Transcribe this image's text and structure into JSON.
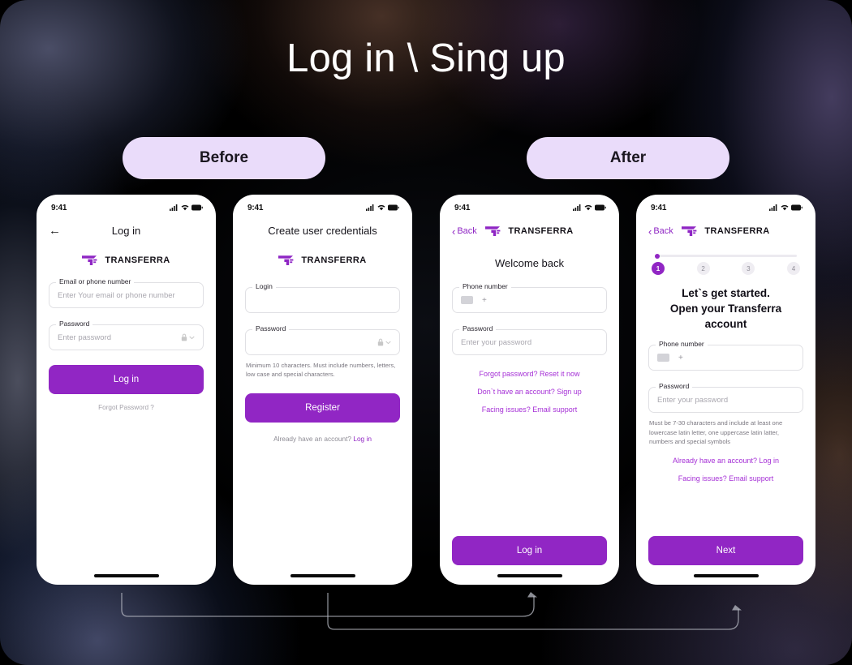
{
  "page": {
    "title": "Log in \\ Sing up",
    "accent": "#9126c4",
    "pill_bg": "#eadcfa"
  },
  "labels": {
    "before": "Before",
    "after": "After"
  },
  "status_bar": {
    "time": "9:41",
    "icons": [
      "signal-icon",
      "wifi-icon",
      "battery-icon"
    ]
  },
  "brand": {
    "name": "TRANSFERRA"
  },
  "screens": [
    {
      "id": "login-before",
      "nav_title": "Log in",
      "back_arrow": "←",
      "fields": [
        {
          "label": "Email or phone number",
          "placeholder": "Enter Your email or phone number"
        },
        {
          "label": "Password",
          "placeholder": "Enter password"
        }
      ],
      "primary_button": "Log in",
      "footer_link": "Forgot Password ?"
    },
    {
      "id": "register-before",
      "heading": "Create user credentials",
      "fields": [
        {
          "label": "Login",
          "placeholder": ""
        },
        {
          "label": "Password",
          "placeholder": ""
        }
      ],
      "helper_text": "Minimum 10 characters. Must include numbers, letters, low case and special characters.",
      "primary_button": "Register",
      "footer_note": "Already have an account?",
      "footer_link": "Log in"
    },
    {
      "id": "login-after",
      "back_label": "Back",
      "heading": "Welcome back",
      "fields": [
        {
          "label": "Phone number",
          "placeholder": "",
          "prefix": "+"
        },
        {
          "label": "Password",
          "placeholder": "Enter your password"
        }
      ],
      "links": [
        "Forgot password? Reset it now",
        "Don`t have an account? Sign up",
        "Facing issues? Email support"
      ],
      "primary_button": "Log in"
    },
    {
      "id": "register-after",
      "back_label": "Back",
      "stepper": {
        "steps": [
          "1",
          "2",
          "3",
          "4"
        ],
        "active": 1
      },
      "heading_line1": "Let`s get started.",
      "heading_line2": "Open your Transferra account",
      "fields": [
        {
          "label": "Phone number",
          "placeholder": "",
          "prefix": "+"
        },
        {
          "label": "Password",
          "placeholder": "Enter your password"
        }
      ],
      "helper_text": "Must be 7-30 characters and include at least one lowercase latin letter, one uppercase latin latter, numbers and special symbols",
      "links": [
        "Already have an account? Log in",
        "Facing issues? Email support"
      ],
      "primary_button": "Next"
    }
  ]
}
